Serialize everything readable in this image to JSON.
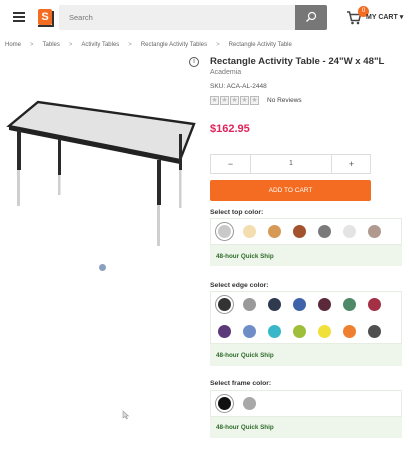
{
  "header": {
    "search_placeholder": "Search",
    "cart_count": "0",
    "cart_label": "MY CART"
  },
  "breadcrumb": [
    "Home",
    "Tables",
    "Activity Tables",
    "Rectangle Activity Tables",
    "Rectangle Activity Table"
  ],
  "product": {
    "title": "Rectangle Activity Table - 24\"W x 48\"L",
    "brand": "Academia",
    "sku": "SKU: ACA-AL-2448",
    "reviews": "No Reviews",
    "price": "$162.95",
    "rating": 0
  },
  "quantity": {
    "minus": "−",
    "value": "1",
    "plus": "+"
  },
  "add_to_cart": "ADD TO CART",
  "top_color": {
    "label": "Select top color:",
    "colors": [
      "#c9c9c9",
      "#f3deb0",
      "#d69a56",
      "#a2532e",
      "#7a7a7a",
      "#e4e4e4",
      "#b09a90"
    ],
    "ship": "48-hour Quick Ship"
  },
  "edge_color": {
    "label": "Select edge color:",
    "colors_row1": [
      "#333333",
      "#9a9a9a",
      "#2f3a4f",
      "#3f63a8",
      "#5b2a3a",
      "#4f8a68",
      "#a33045"
    ],
    "colors_row2": [
      "#5c3a7a",
      "#6f8ec8",
      "#39b7c9",
      "#9fbe3a",
      "#f1e03a",
      "#ee8030",
      "#505050"
    ],
    "ship": "48-hour Quick Ship"
  },
  "frame_color": {
    "label": "Select frame color:",
    "colors": [
      "#111111",
      "#a8a8a8"
    ],
    "ship": "48-hour Quick Ship"
  }
}
